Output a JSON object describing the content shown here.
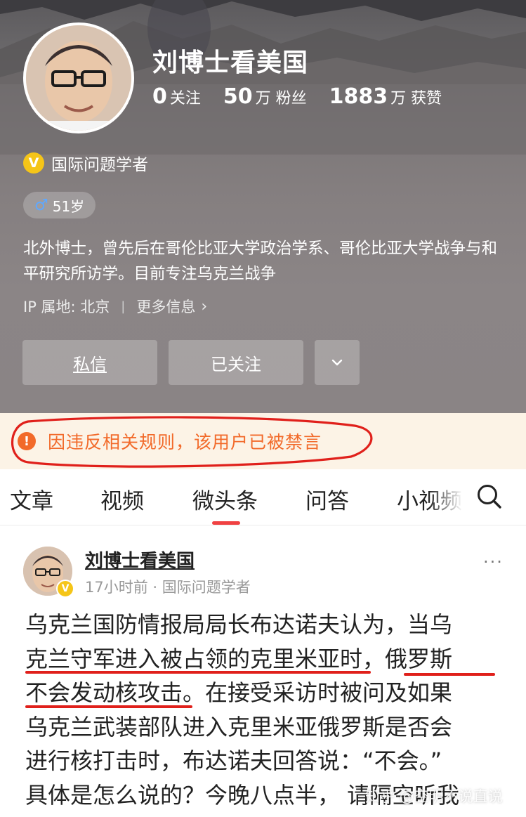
{
  "profile": {
    "name": "刘博士看美国",
    "stats": [
      {
        "num": "0",
        "label": "关注"
      },
      {
        "num": "50",
        "label": "万 粉丝"
      },
      {
        "num": "1883",
        "label": "万 获赞"
      }
    ],
    "certification": "国际问题学者",
    "badge_letter": "V",
    "age": "51岁",
    "bio": "北外博士，曾先后在哥伦比亚大学政治学系、哥伦比亚大学战争与和平研究所访学。目前专注乌克兰战争",
    "ip_location": "IP 属地: 北京",
    "more_info": "更多信息",
    "buttons": {
      "message": "私信",
      "followed": "已关注"
    }
  },
  "notice": {
    "text": "因违反相关规则，该用户已被禁言",
    "color": "#f26a2a"
  },
  "tabs": [
    {
      "label": "文章"
    },
    {
      "label": "视频"
    },
    {
      "label": "微头条"
    },
    {
      "label": "问答"
    },
    {
      "label": "小视频"
    }
  ],
  "active_tab": "微头条",
  "post": {
    "author": "刘博士看美国",
    "meta": "17小时前 · 国际问题学者",
    "more": "···",
    "body_lines": [
      "乌克兰国防情报局局长布达诺夫认为，当乌",
      "克兰守军进入被占领的克里米亚时，俄罗斯",
      "不会发动核攻击。在接受采访时被问及如果",
      "乌克兰武装部队进入克里米亚俄罗斯是否会",
      "进行核打击时，布达诺夫回答说：“不会。”",
      "具体是怎么说的？今晚八点半， 请隔空听我"
    ]
  },
  "watermark": "知乎 @空明不说直说",
  "colors": {
    "accent_red": "#f04142",
    "annotation_red": "#e0201b",
    "verify_gold": "#f5c518"
  }
}
